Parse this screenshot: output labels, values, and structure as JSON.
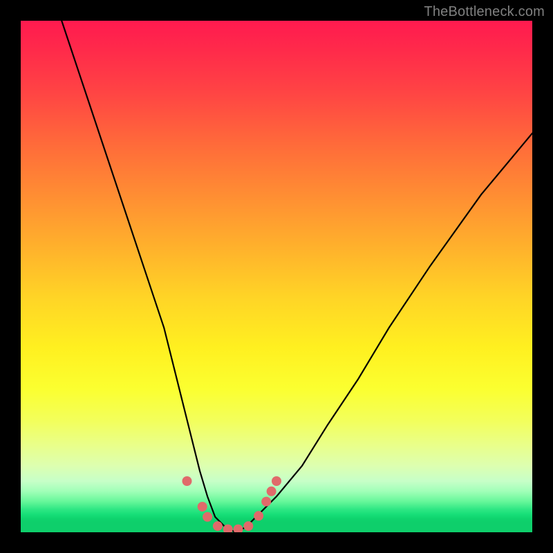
{
  "watermark": "TheBottleneck.com",
  "chart_data": {
    "type": "line",
    "title": "",
    "xlabel": "",
    "ylabel": "",
    "xlim": [
      0,
      100
    ],
    "ylim": [
      0,
      100
    ],
    "grid": false,
    "note": "V-shaped curve over a vertical red→orange→yellow→green gradient indicating bottleneck severity (red = high bottleneck at top, green = balanced at bottom). Axes are unlabeled; values estimated from pixel positions on a 0–100 scale.",
    "series": [
      {
        "name": "bottleneck-curve",
        "x": [
          8,
          12,
          16,
          20,
          24,
          28,
          31,
          33,
          35,
          36.5,
          38,
          40,
          42,
          44,
          46,
          50,
          55,
          60,
          66,
          72,
          80,
          90,
          100
        ],
        "y": [
          100,
          88,
          76,
          64,
          52,
          40,
          28,
          20,
          12,
          7,
          3,
          1,
          0,
          1,
          3,
          7,
          13,
          21,
          30,
          40,
          52,
          66,
          78
        ]
      }
    ],
    "markers": {
      "name": "highlight-dots",
      "color": "#e06a6a",
      "points": [
        {
          "x": 32.5,
          "y": 10
        },
        {
          "x": 35.5,
          "y": 5
        },
        {
          "x": 36.5,
          "y": 3
        },
        {
          "x": 38.5,
          "y": 1.2
        },
        {
          "x": 40.5,
          "y": 0.6
        },
        {
          "x": 42.5,
          "y": 0.6
        },
        {
          "x": 44.5,
          "y": 1.2
        },
        {
          "x": 46.5,
          "y": 3.2
        },
        {
          "x": 48.0,
          "y": 6
        },
        {
          "x": 49.0,
          "y": 8
        },
        {
          "x": 50.0,
          "y": 10
        }
      ]
    }
  }
}
